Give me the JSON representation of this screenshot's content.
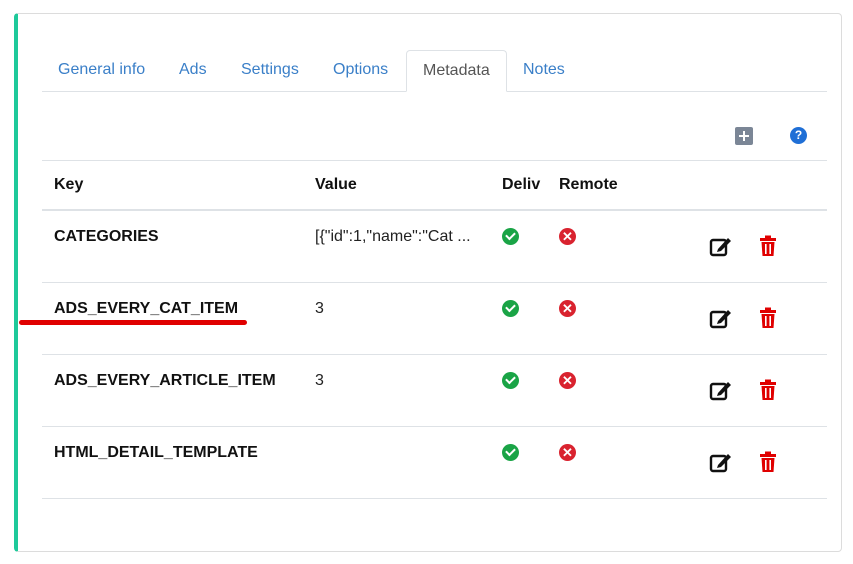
{
  "tabs": [
    "General info",
    "Ads",
    "Settings",
    "Options",
    "Metadata",
    "Notes"
  ],
  "active_tab": "Metadata",
  "toolbar": {
    "add_icon": "plus-square-icon",
    "help_icon": "question-circle-icon",
    "help_glyph": "?"
  },
  "table": {
    "headers": {
      "key": "Key",
      "value": "Value",
      "deliv": "Deliv",
      "remote": "Remote"
    },
    "rows": [
      {
        "key": "CATEGORIES",
        "value": "[{\"id\":1,\"name\":\"Cat ...",
        "deliv": true,
        "remote": false
      },
      {
        "key": "ADS_EVERY_CAT_ITEM",
        "value": "3",
        "deliv": true,
        "remote": false
      },
      {
        "key": "ADS_EVERY_ARTICLE_ITEM",
        "value": "3",
        "deliv": true,
        "remote": false
      },
      {
        "key": "HTML_DETAIL_TEMPLATE",
        "value": "",
        "deliv": true,
        "remote": false
      }
    ]
  },
  "colors": {
    "accent": "#1ec99a",
    "link": "#3a7fc8",
    "ok": "#1aa446",
    "error": "#d9232f",
    "delete": "#e00000",
    "annotation": "#e00000"
  },
  "annotation": {
    "underlined_key": "ADS_EVERY_CAT_ITEM"
  }
}
